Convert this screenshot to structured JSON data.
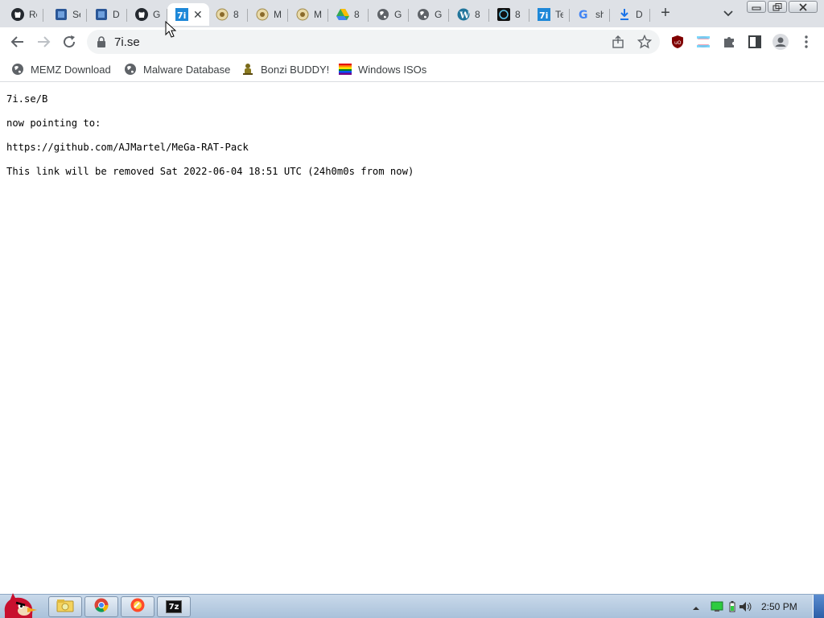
{
  "browser": {
    "tabs": [
      {
        "title": "Re",
        "icon": "github-icon",
        "active": false
      },
      {
        "title": "Se",
        "icon": "blue-square-icon",
        "active": false
      },
      {
        "title": "D",
        "icon": "blue-square-icon",
        "active": false
      },
      {
        "title": "G",
        "icon": "github-icon",
        "active": false
      },
      {
        "title": "7i",
        "icon": "7i-icon",
        "active": true
      },
      {
        "title": "8",
        "icon": "gold-badge-icon",
        "active": false
      },
      {
        "title": "M",
        "icon": "gold-badge-icon",
        "active": false
      },
      {
        "title": "M",
        "icon": "gold-badge-icon",
        "active": false
      },
      {
        "title": "8",
        "icon": "drive-icon",
        "active": false
      },
      {
        "title": "G",
        "icon": "globe-icon",
        "active": false
      },
      {
        "title": "G",
        "icon": "globe-icon",
        "active": false
      },
      {
        "title": "8",
        "icon": "wordpress-icon",
        "active": false
      },
      {
        "title": "8",
        "icon": "dark-app-icon",
        "active": false
      },
      {
        "title": "Te",
        "icon": "7i-icon",
        "active": false
      },
      {
        "title": "sh",
        "icon": "google-icon",
        "active": false
      },
      {
        "title": "D",
        "icon": "download-icon",
        "active": false
      }
    ],
    "new_tab_label": "+",
    "address": {
      "url": "7i.se"
    },
    "bookmarks": [
      {
        "label": "MEMZ Download",
        "icon": "globe-icon"
      },
      {
        "label": "Malware Database",
        "icon": "globe-icon"
      },
      {
        "label": "Bonzi BUDDY!",
        "icon": "bonzi-icon"
      },
      {
        "label": "Windows ISOs",
        "icon": "windows-flag-icon"
      }
    ]
  },
  "page": {
    "line1": "7i.se/B",
    "line2": "now pointing to:",
    "line3": "https://github.com/AJMartel/MeGa-RAT-Pack",
    "line4": "This link will be removed Sat 2022-06-04 18:51 UTC (24h0m0s from now)"
  },
  "taskbar": {
    "pinned": [
      "explorer-icon",
      "chrome-icon",
      "opera-icon",
      "7zip-icon"
    ],
    "sevenzip_label": "7z",
    "clock": "2:50 PM"
  },
  "colors": {
    "tabstrip": "#dee1e6",
    "omnibox": "#f1f3f4",
    "taskbar": "#b9cde2",
    "text": "#202124"
  }
}
